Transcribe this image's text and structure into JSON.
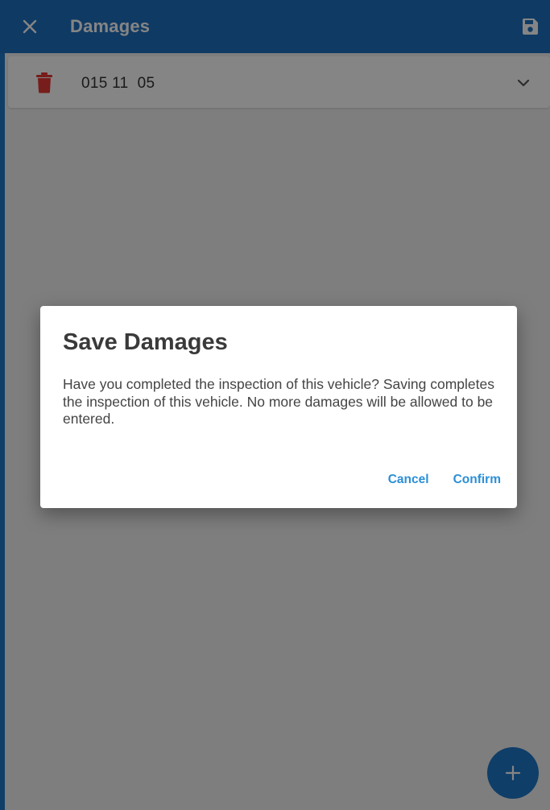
{
  "app_bar": {
    "title": "Damages",
    "close_icon": "close-icon",
    "save_icon": "save-icon"
  },
  "damages": {
    "items": [
      {
        "code": "015 11  05",
        "delete_icon": "trash-icon",
        "expand_icon": "chevron-down-icon"
      }
    ]
  },
  "dialog": {
    "title": "Save Damages",
    "message": "Have you completed the inspection of this vehicle? Saving completes the inspection of this vehicle. No more damages will be allowed to be entered.",
    "cancel_label": "Cancel",
    "confirm_label": "Confirm"
  },
  "fab": {
    "icon": "plus-icon"
  },
  "colors": {
    "primary": "#1e6fc0",
    "accent": "#2b8fd6",
    "danger": "#e53935"
  }
}
